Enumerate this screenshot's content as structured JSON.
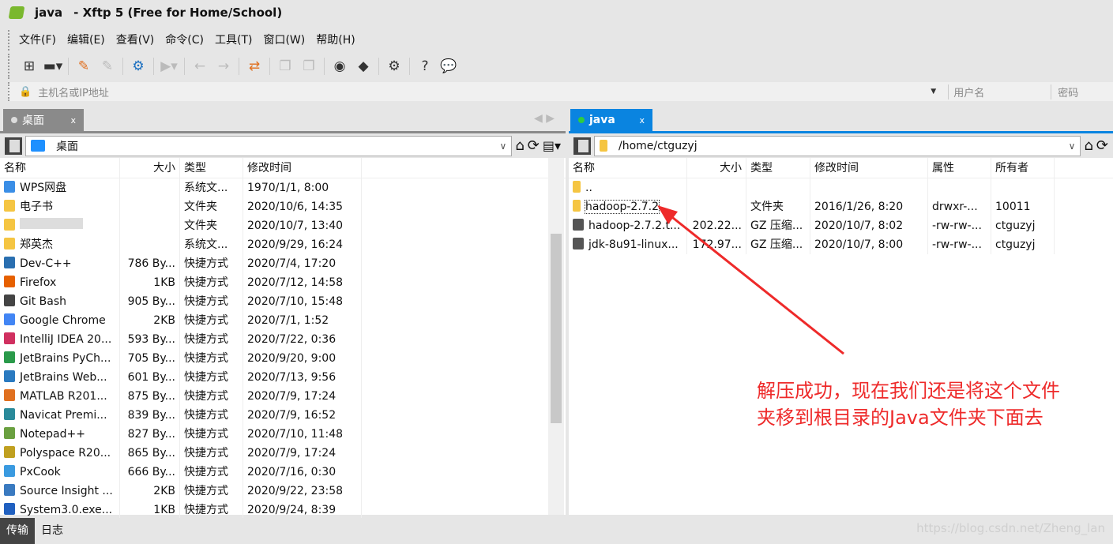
{
  "window": {
    "title_session": "java",
    "title_app": "- Xftp 5 (Free for Home/School)"
  },
  "menu": [
    "文件(F)",
    "编辑(E)",
    "查看(V)",
    "命令(C)",
    "工具(T)",
    "窗口(W)",
    "帮助(H)"
  ],
  "address": {
    "host_placeholder": "主机名或IP地址",
    "user_placeholder": "用户名",
    "password_placeholder": "密码"
  },
  "left": {
    "tab": "桌面",
    "path": "桌面",
    "columns": [
      "名称",
      "大小",
      "类型",
      "修改时间"
    ],
    "rows": [
      [
        "WPS网盘",
        "",
        "系统文...",
        "1970/1/1, 8:00"
      ],
      [
        "电子书",
        "",
        "文件夹",
        "2020/10/6, 14:35"
      ],
      [
        "",
        "",
        "文件夹",
        "2020/10/7, 13:40"
      ],
      [
        "郑英杰",
        "",
        "系统文...",
        "2020/9/29, 16:24"
      ],
      [
        "Dev-C++",
        "786 By...",
        "快捷方式",
        "2020/7/4, 17:20"
      ],
      [
        "Firefox",
        "1KB",
        "快捷方式",
        "2020/7/12, 14:58"
      ],
      [
        "Git Bash",
        "905 By...",
        "快捷方式",
        "2020/7/10, 15:48"
      ],
      [
        "Google Chrome",
        "2KB",
        "快捷方式",
        "2020/7/1, 1:52"
      ],
      [
        "IntelliJ IDEA 20...",
        "593 By...",
        "快捷方式",
        "2020/7/22, 0:36"
      ],
      [
        "JetBrains PyCh...",
        "705 By...",
        "快捷方式",
        "2020/9/20, 9:00"
      ],
      [
        "JetBrains Web...",
        "601 By...",
        "快捷方式",
        "2020/7/13, 9:56"
      ],
      [
        "MATLAB R201...",
        "875 By...",
        "快捷方式",
        "2020/7/9, 17:24"
      ],
      [
        "Navicat Premi...",
        "839 By...",
        "快捷方式",
        "2020/7/9, 16:52"
      ],
      [
        "Notepad++",
        "827 By...",
        "快捷方式",
        "2020/7/10, 11:48"
      ],
      [
        "Polyspace R20...",
        "865 By...",
        "快捷方式",
        "2020/7/9, 17:24"
      ],
      [
        "PxCook",
        "666 By...",
        "快捷方式",
        "2020/7/16, 0:30"
      ],
      [
        "Source Insight ...",
        "2KB",
        "快捷方式",
        "2020/9/22, 23:58"
      ],
      [
        "System3.0.exe...",
        "1KB",
        "快捷方式",
        "2020/9/24, 8:39"
      ]
    ]
  },
  "right": {
    "tab": "java",
    "path": "/home/ctguzyj",
    "columns": [
      "名称",
      "大小",
      "类型",
      "修改时间",
      "属性",
      "所有者"
    ],
    "rows": [
      [
        "..",
        "",
        "",
        "",
        "",
        ""
      ],
      [
        "hadoop-2.7.2",
        "",
        "文件夹",
        "2016/1/26, 8:20",
        "drwxr-...",
        "10011"
      ],
      [
        "hadoop-2.7.2.t...",
        "202.22...",
        "GZ 压缩...",
        "2020/10/7, 8:02",
        "-rw-rw-...",
        "ctguzyj"
      ],
      [
        "jdk-8u91-linux...",
        "172.97...",
        "GZ 压缩...",
        "2020/10/7, 8:00",
        "-rw-rw-...",
        "ctguzyj"
      ]
    ]
  },
  "status": {
    "tabs": [
      "传输",
      "日志"
    ]
  },
  "annotation": {
    "line1": "解压成功，现在我们还是将这个文件",
    "line2": "夹移到根目录的Java文件夹下面去"
  },
  "watermark": "https://blog.csdn.net/Zheng_lan",
  "colors": {
    "active_tab": "#0a84e0",
    "annotation": "#ee2a2a",
    "folder": "#f5c542"
  }
}
